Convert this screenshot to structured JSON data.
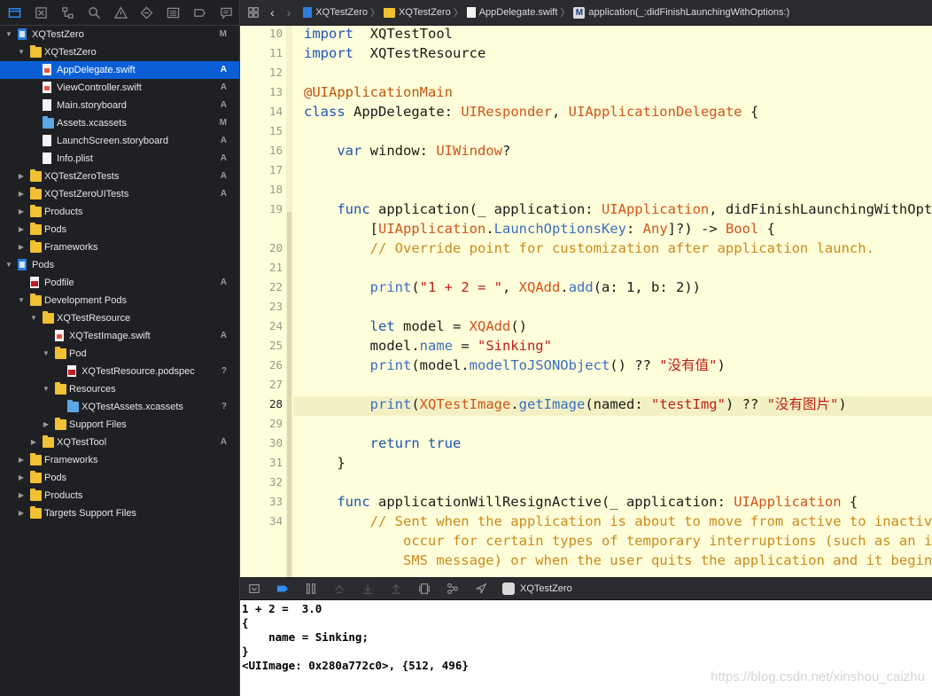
{
  "navigator": {
    "tabs": [
      "project-navigator-icon",
      "source-control-icon",
      "symbol-navigator-icon",
      "find-navigator-icon",
      "issue-navigator-icon",
      "test-navigator-icon",
      "debug-navigator-icon",
      "breakpoint-navigator-icon",
      "report-navigator-icon"
    ]
  },
  "tree": [
    {
      "label": "XQTestZero",
      "badge": "M",
      "depth": 0,
      "disc": "down",
      "icon": "project"
    },
    {
      "label": "XQTestZero",
      "badge": "",
      "depth": 1,
      "disc": "down",
      "icon": "folder"
    },
    {
      "label": "AppDelegate.swift",
      "badge": "A",
      "depth": 2,
      "disc": "",
      "icon": "swift",
      "selected": true
    },
    {
      "label": "ViewController.swift",
      "badge": "A",
      "depth": 2,
      "disc": "",
      "icon": "swift"
    },
    {
      "label": "Main.storyboard",
      "badge": "A",
      "depth": 2,
      "disc": "",
      "icon": "file"
    },
    {
      "label": "Assets.xcassets",
      "badge": "M",
      "depth": 2,
      "disc": "",
      "icon": "bluefolder"
    },
    {
      "label": "LaunchScreen.storyboard",
      "badge": "A",
      "depth": 2,
      "disc": "",
      "icon": "file"
    },
    {
      "label": "Info.plist",
      "badge": "A",
      "depth": 2,
      "disc": "",
      "icon": "file"
    },
    {
      "label": "XQTestZeroTests",
      "badge": "A",
      "depth": 1,
      "disc": "right",
      "icon": "folder"
    },
    {
      "label": "XQTestZeroUITests",
      "badge": "A",
      "depth": 1,
      "disc": "right",
      "icon": "folder"
    },
    {
      "label": "Products",
      "badge": "",
      "depth": 1,
      "disc": "right",
      "icon": "folder"
    },
    {
      "label": "Pods",
      "badge": "",
      "depth": 1,
      "disc": "right",
      "icon": "folder"
    },
    {
      "label": "Frameworks",
      "badge": "",
      "depth": 1,
      "disc": "right",
      "icon": "folder"
    },
    {
      "label": "Pods",
      "badge": "",
      "depth": 0,
      "disc": "down",
      "icon": "project"
    },
    {
      "label": "Podfile",
      "badge": "A",
      "depth": 1,
      "disc": "",
      "icon": "ruby"
    },
    {
      "label": "Development Pods",
      "badge": "",
      "depth": 1,
      "disc": "down",
      "icon": "folder"
    },
    {
      "label": "XQTestResource",
      "badge": "",
      "depth": 2,
      "disc": "down",
      "icon": "folder"
    },
    {
      "label": "XQTestImage.swift",
      "badge": "A",
      "depth": 3,
      "disc": "",
      "icon": "swift"
    },
    {
      "label": "Pod",
      "badge": "",
      "depth": 3,
      "disc": "down",
      "icon": "folder"
    },
    {
      "label": "XQTestResource.podspec",
      "badge": "?",
      "depth": 4,
      "disc": "",
      "icon": "ruby"
    },
    {
      "label": "Resources",
      "badge": "",
      "depth": 3,
      "disc": "down",
      "icon": "folder"
    },
    {
      "label": "XQTestAssets.xcassets",
      "badge": "?",
      "depth": 4,
      "disc": "",
      "icon": "bluefolder"
    },
    {
      "label": "Support Files",
      "badge": "",
      "depth": 3,
      "disc": "right",
      "icon": "folder"
    },
    {
      "label": "XQTestTool",
      "badge": "A",
      "depth": 2,
      "disc": "right",
      "icon": "folder"
    },
    {
      "label": "Frameworks",
      "badge": "",
      "depth": 1,
      "disc": "right",
      "icon": "folder"
    },
    {
      "label": "Pods",
      "badge": "",
      "depth": 1,
      "disc": "right",
      "icon": "folder"
    },
    {
      "label": "Products",
      "badge": "",
      "depth": 1,
      "disc": "right",
      "icon": "folder"
    },
    {
      "label": "Targets Support Files",
      "badge": "",
      "depth": 1,
      "disc": "right",
      "icon": "folder"
    }
  ],
  "jumpbar": {
    "project": "XQTestZero",
    "group": "XQTestZero",
    "file": "AppDelegate.swift",
    "method_badge": "M",
    "method": "application(_:didFinishLaunchingWithOptions:)"
  },
  "editor": {
    "current_line": "28",
    "lines": [
      {
        "n": "10",
        "tokens": [
          [
            "k",
            "import"
          ],
          [
            "",
            "  XQTestTool"
          ]
        ]
      },
      {
        "n": "11",
        "tokens": [
          [
            "k",
            "import"
          ],
          [
            "",
            "  XQTestResource"
          ]
        ]
      },
      {
        "n": "12",
        "tokens": []
      },
      {
        "n": "13",
        "tokens": [
          [
            "a",
            "@UIApplicationMain"
          ]
        ]
      },
      {
        "n": "14",
        "tokens": [
          [
            "k",
            "class"
          ],
          [
            "",
            " AppDelegate: "
          ],
          [
            "t",
            "UIResponder"
          ],
          [
            "",
            ", "
          ],
          [
            "t",
            "UIApplicationDelegate"
          ],
          [
            "",
            " {"
          ]
        ]
      },
      {
        "n": "15",
        "tokens": []
      },
      {
        "n": "16",
        "tokens": [
          [
            "",
            "    "
          ],
          [
            "k",
            "var"
          ],
          [
            "",
            " window: "
          ],
          [
            "t",
            "UIWindow"
          ],
          [
            "",
            "?"
          ]
        ]
      },
      {
        "n": "17",
        "tokens": []
      },
      {
        "n": "18",
        "tokens": []
      },
      {
        "n": "19",
        "tokens": [
          [
            "",
            "    "
          ],
          [
            "k",
            "func"
          ],
          [
            "",
            " application(_ application: "
          ],
          [
            "t",
            "UIApplication"
          ],
          [
            "",
            ", didFinishLaunchingWithOptions launchOptions:"
          ]
        ]
      },
      {
        "n": "",
        "tokens": [
          [
            "",
            "        ["
          ],
          [
            "t",
            "UIApplication"
          ],
          [
            "",
            "."
          ],
          [
            "p",
            "LaunchOptionsKey"
          ],
          [
            "",
            ": "
          ],
          [
            "t",
            "Any"
          ],
          [
            "",
            "]?) -> "
          ],
          [
            "t",
            "Bool"
          ],
          [
            "",
            " {"
          ]
        ]
      },
      {
        "n": "20",
        "tokens": [
          [
            "",
            "        "
          ],
          [
            "c",
            "// Override point for customization after application launch."
          ]
        ]
      },
      {
        "n": "21",
        "tokens": []
      },
      {
        "n": "22",
        "tokens": [
          [
            "",
            "        "
          ],
          [
            "p",
            "print"
          ],
          [
            "",
            "("
          ],
          [
            "s",
            "\"1 + 2 = \""
          ],
          [
            "",
            ", "
          ],
          [
            "t",
            "XQAdd"
          ],
          [
            "",
            "."
          ],
          [
            "p",
            "add"
          ],
          [
            "",
            "(a: 1, b: 2))"
          ]
        ]
      },
      {
        "n": "23",
        "tokens": []
      },
      {
        "n": "24",
        "tokens": [
          [
            "",
            "        "
          ],
          [
            "k",
            "let"
          ],
          [
            "",
            " model = "
          ],
          [
            "t",
            "XQAdd"
          ],
          [
            "",
            "()"
          ]
        ]
      },
      {
        "n": "25",
        "tokens": [
          [
            "",
            "        model."
          ],
          [
            "p",
            "name"
          ],
          [
            "",
            " = "
          ],
          [
            "s",
            "\"Sinking\""
          ]
        ]
      },
      {
        "n": "26",
        "tokens": [
          [
            "",
            "        "
          ],
          [
            "p",
            "print"
          ],
          [
            "",
            "(model."
          ],
          [
            "p",
            "modelToJSONObject"
          ],
          [
            "",
            "() ?? "
          ],
          [
            "s",
            "\"没有值\""
          ],
          [
            "",
            ")"
          ]
        ]
      },
      {
        "n": "27",
        "tokens": []
      },
      {
        "n": "28",
        "tokens": [
          [
            "",
            "        "
          ],
          [
            "p",
            "print"
          ],
          [
            "",
            "("
          ],
          [
            "t",
            "XQTestImage"
          ],
          [
            "",
            "."
          ],
          [
            "p",
            "getImage"
          ],
          [
            "",
            "(named: "
          ],
          [
            "s",
            "\"testImg\""
          ],
          [
            "",
            ") ?? "
          ],
          [
            "s",
            "\"没有图片\""
          ],
          [
            "",
            ")"
          ]
        ]
      },
      {
        "n": "29",
        "tokens": []
      },
      {
        "n": "30",
        "tokens": [
          [
            "",
            "        "
          ],
          [
            "k",
            "return"
          ],
          [
            "",
            " "
          ],
          [
            "k",
            "true"
          ]
        ]
      },
      {
        "n": "31",
        "tokens": [
          [
            "",
            "    }"
          ]
        ]
      },
      {
        "n": "32",
        "tokens": []
      },
      {
        "n": "33",
        "tokens": [
          [
            "",
            "    "
          ],
          [
            "k",
            "func"
          ],
          [
            "",
            " applicationWillResignActive(_ application: "
          ],
          [
            "t",
            "UIApplication"
          ],
          [
            "",
            " {"
          ]
        ]
      },
      {
        "n": "34",
        "tokens": [
          [
            "",
            "        "
          ],
          [
            "c",
            "// Sent when the application is about to move from active to inactive state."
          ]
        ]
      },
      {
        "n": "",
        "tokens": [
          [
            "",
            "            "
          ],
          [
            "c",
            "occur for certain types of temporary interruptions (such as an incoming"
          ]
        ]
      },
      {
        "n": "",
        "tokens": [
          [
            "",
            "            "
          ],
          [
            "c",
            "SMS message) or when the user quits the application and it begins"
          ]
        ]
      }
    ]
  },
  "debugbar": {
    "target": "XQTestZero"
  },
  "console": {
    "lines": [
      "1 + 2 =  3.0",
      "{",
      "    name = Sinking;",
      "}",
      "<UIImage: 0x280a772c0>, {512, 496}"
    ],
    "watermark": "https://blog.csdn.net/xinshou_caizhu"
  }
}
